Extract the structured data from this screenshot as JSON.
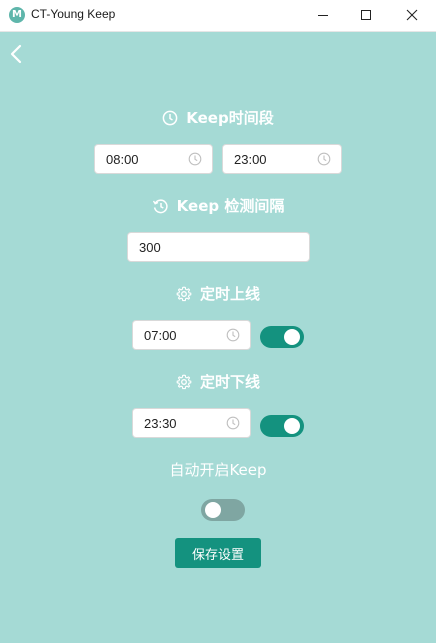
{
  "window": {
    "app_icon_letter": "M",
    "title": "CT-Young Keep"
  },
  "keep_period": {
    "title": "Keep时间段",
    "start": "08:00",
    "end": "23:00"
  },
  "keep_interval": {
    "title": "Keep 检测间隔",
    "value": "300"
  },
  "scheduled_online": {
    "title": "定时上线",
    "time": "07:00",
    "enabled": true
  },
  "scheduled_offline": {
    "title": "定时下线",
    "time": "23:30",
    "enabled": true
  },
  "auto_start": {
    "title": "自动开启Keep",
    "enabled": false
  },
  "save_button": {
    "label": "保存设置"
  },
  "colors": {
    "background": "#a5dad5",
    "accent": "#14927f",
    "toggle_off": "#7fa6a2"
  },
  "icons": [
    "back-chevron-icon",
    "clock-icon",
    "history-icon",
    "gear-icon"
  ]
}
